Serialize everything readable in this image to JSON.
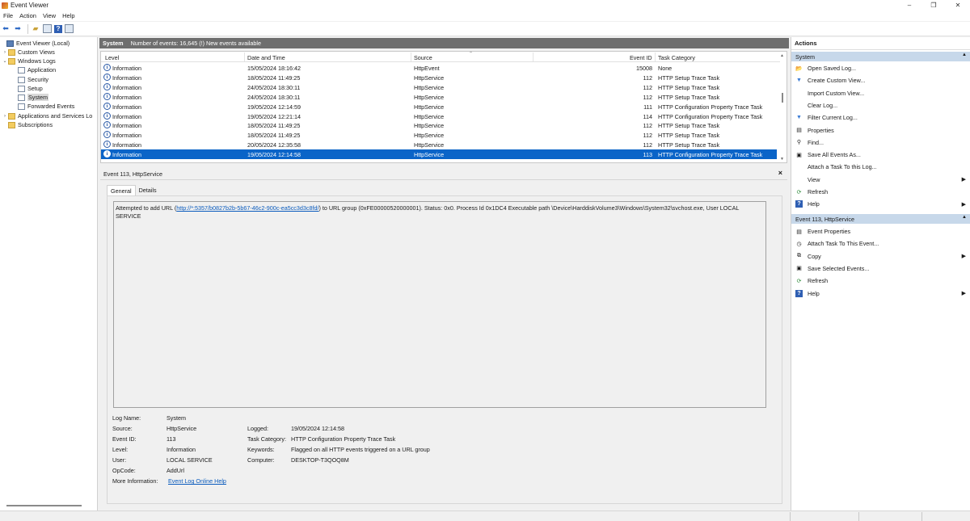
{
  "window": {
    "title": "Event Viewer",
    "controls": [
      "–",
      "❐",
      "✕"
    ]
  },
  "menu": [
    "File",
    "Action",
    "View",
    "Help"
  ],
  "tree": {
    "items": [
      {
        "label": "Event Viewer (Local)",
        "level": 0,
        "expander": "",
        "icon": "pc",
        "selected": false
      },
      {
        "label": "Custom Views",
        "level": 1,
        "expander": "›",
        "icon": "folder",
        "selected": false
      },
      {
        "label": "Windows Logs",
        "level": 1,
        "expander": "⌄",
        "icon": "folder",
        "selected": false
      },
      {
        "label": "Application",
        "level": 2,
        "expander": "",
        "icon": "log",
        "selected": false
      },
      {
        "label": "Security",
        "level": 2,
        "expander": "",
        "icon": "log",
        "selected": false
      },
      {
        "label": "Setup",
        "level": 2,
        "expander": "",
        "icon": "log",
        "selected": false
      },
      {
        "label": "System",
        "level": 2,
        "expander": "",
        "icon": "log",
        "selected": true
      },
      {
        "label": "Forwarded Events",
        "level": 2,
        "expander": "",
        "icon": "log",
        "selected": false
      },
      {
        "label": "Applications and Services Lo",
        "level": 1,
        "expander": "›",
        "icon": "folder",
        "selected": false
      },
      {
        "label": "Subscriptions",
        "level": 1,
        "expander": "",
        "icon": "folder",
        "selected": false
      }
    ]
  },
  "header": {
    "name": "System",
    "info": "Number of events: 16,645 (!) New events available"
  },
  "grid": {
    "columns": {
      "level": "Level",
      "date": "Date and Time",
      "source": "Source",
      "event_id": "Event ID",
      "task": "Task Category"
    },
    "rows": [
      {
        "level": "Information",
        "date": "15/05/2024 18:16:42",
        "source": "HttpEvent",
        "event_id": "15008",
        "task": "None"
      },
      {
        "level": "Information",
        "date": "18/05/2024 11:49:25",
        "source": "HttpService",
        "event_id": "112",
        "task": "HTTP Setup Trace Task"
      },
      {
        "level": "Information",
        "date": "24/05/2024 18:30:11",
        "source": "HttpService",
        "event_id": "112",
        "task": "HTTP Setup Trace Task"
      },
      {
        "level": "Information",
        "date": "24/05/2024 18:30:11",
        "source": "HttpService",
        "event_id": "112",
        "task": "HTTP Setup Trace Task"
      },
      {
        "level": "Information",
        "date": "19/05/2024 12:14:59",
        "source": "HttpService",
        "event_id": "111",
        "task": "HTTP Configuration Property Trace Task"
      },
      {
        "level": "Information",
        "date": "19/05/2024 12:21:14",
        "source": "HttpService",
        "event_id": "114",
        "task": "HTTP Configuration Property Trace Task"
      },
      {
        "level": "Information",
        "date": "18/05/2024 11:49:25",
        "source": "HttpService",
        "event_id": "112",
        "task": "HTTP Setup Trace Task"
      },
      {
        "level": "Information",
        "date": "18/05/2024 11:49:25",
        "source": "HttpService",
        "event_id": "112",
        "task": "HTTP Setup Trace Task"
      },
      {
        "level": "Information",
        "date": "20/05/2024 12:35:58",
        "source": "HttpService",
        "event_id": "112",
        "task": "HTTP Setup Trace Task"
      },
      {
        "level": "Information",
        "date": "19/05/2024 12:14:58",
        "source": "HttpService",
        "event_id": "113",
        "task": "HTTP Configuration Property Trace Task",
        "selected": true
      }
    ]
  },
  "detail": {
    "title": "Event 113, HttpService",
    "close": "×",
    "tabs": [
      "General",
      "Details"
    ],
    "description": {
      "before": "Attempted to add URL (",
      "url": "http://*:5357/b0827b2b-5b67-46c2-900c-ea5cc3d3c8fd/",
      "after": ") to URL group (0xFE00000520000001). Status: 0x0. Process Id 0x1DC4 Executable path \\Device\\HarddiskVolume3\\Windows\\System32\\svchost.exe, User LOCAL SERVICE"
    },
    "props": {
      "log_name_label": "Log Name:",
      "log_name": "System",
      "source_label": "Source:",
      "source": "HttpService",
      "logged_label": "Logged:",
      "logged": "19/05/2024 12:14:58",
      "event_id_label": "Event ID:",
      "event_id": "113",
      "task_label": "Task Category:",
      "task": "HTTP Configuration Property Trace Task",
      "level_label": "Level:",
      "level": "Information",
      "keywords_label": "Keywords:",
      "keywords": "Flagged on all HTTP events triggered on a URL group",
      "user_label": "User:",
      "user": "LOCAL SERVICE",
      "computer_label": "Computer:",
      "computer": "DESKTOP-T3QOQ8M",
      "opcode_label": "OpCode:",
      "opcode": "AddUrl",
      "more_label": "More Information:",
      "more_link": "Event Log Online Help"
    }
  },
  "actions": {
    "title": "Actions",
    "section1": "System",
    "items1": [
      {
        "label": "Open Saved Log...",
        "icon": "open-folder-icon",
        "glyph": "📂",
        "sub": false
      },
      {
        "label": "Create Custom View...",
        "icon": "filter-icon",
        "glyph": "▼",
        "sub": false
      },
      {
        "label": "Import Custom View...",
        "icon": "",
        "glyph": "",
        "sub": false
      },
      {
        "label": "Clear Log...",
        "icon": "",
        "glyph": "",
        "sub": false
      },
      {
        "label": "Filter Current Log...",
        "icon": "filter-icon",
        "glyph": "▼",
        "sub": false
      },
      {
        "label": "Properties",
        "icon": "properties-icon",
        "glyph": "▤",
        "sub": false
      },
      {
        "label": "Find...",
        "icon": "binoculars-icon",
        "glyph": "⚲",
        "sub": false
      },
      {
        "label": "Save All Events As...",
        "icon": "save-icon",
        "glyph": "▣",
        "sub": false
      },
      {
        "label": "Attach a Task To this Log...",
        "icon": "",
        "glyph": "",
        "sub": false
      },
      {
        "label": "View",
        "icon": "",
        "glyph": "",
        "sub": true
      },
      {
        "label": "Refresh",
        "icon": "refresh-icon",
        "glyph": "⟳",
        "sub": false
      },
      {
        "label": "Help",
        "icon": "help-icon",
        "glyph": "?",
        "sub": true
      }
    ],
    "section2": "Event 113, HttpService",
    "items2": [
      {
        "label": "Event Properties",
        "icon": "event-properties-icon",
        "glyph": "▤",
        "sub": false
      },
      {
        "label": "Attach Task To This Event...",
        "icon": "task-icon",
        "glyph": "◷",
        "sub": false
      },
      {
        "label": "Copy",
        "icon": "copy-icon",
        "glyph": "⧉",
        "sub": true
      },
      {
        "label": "Save Selected Events...",
        "icon": "save-icon",
        "glyph": "▣",
        "sub": false
      },
      {
        "label": "Refresh",
        "icon": "refresh-icon",
        "glyph": "⟳",
        "sub": false
      },
      {
        "label": "Help",
        "icon": "help-icon",
        "glyph": "?",
        "sub": true
      }
    ]
  }
}
